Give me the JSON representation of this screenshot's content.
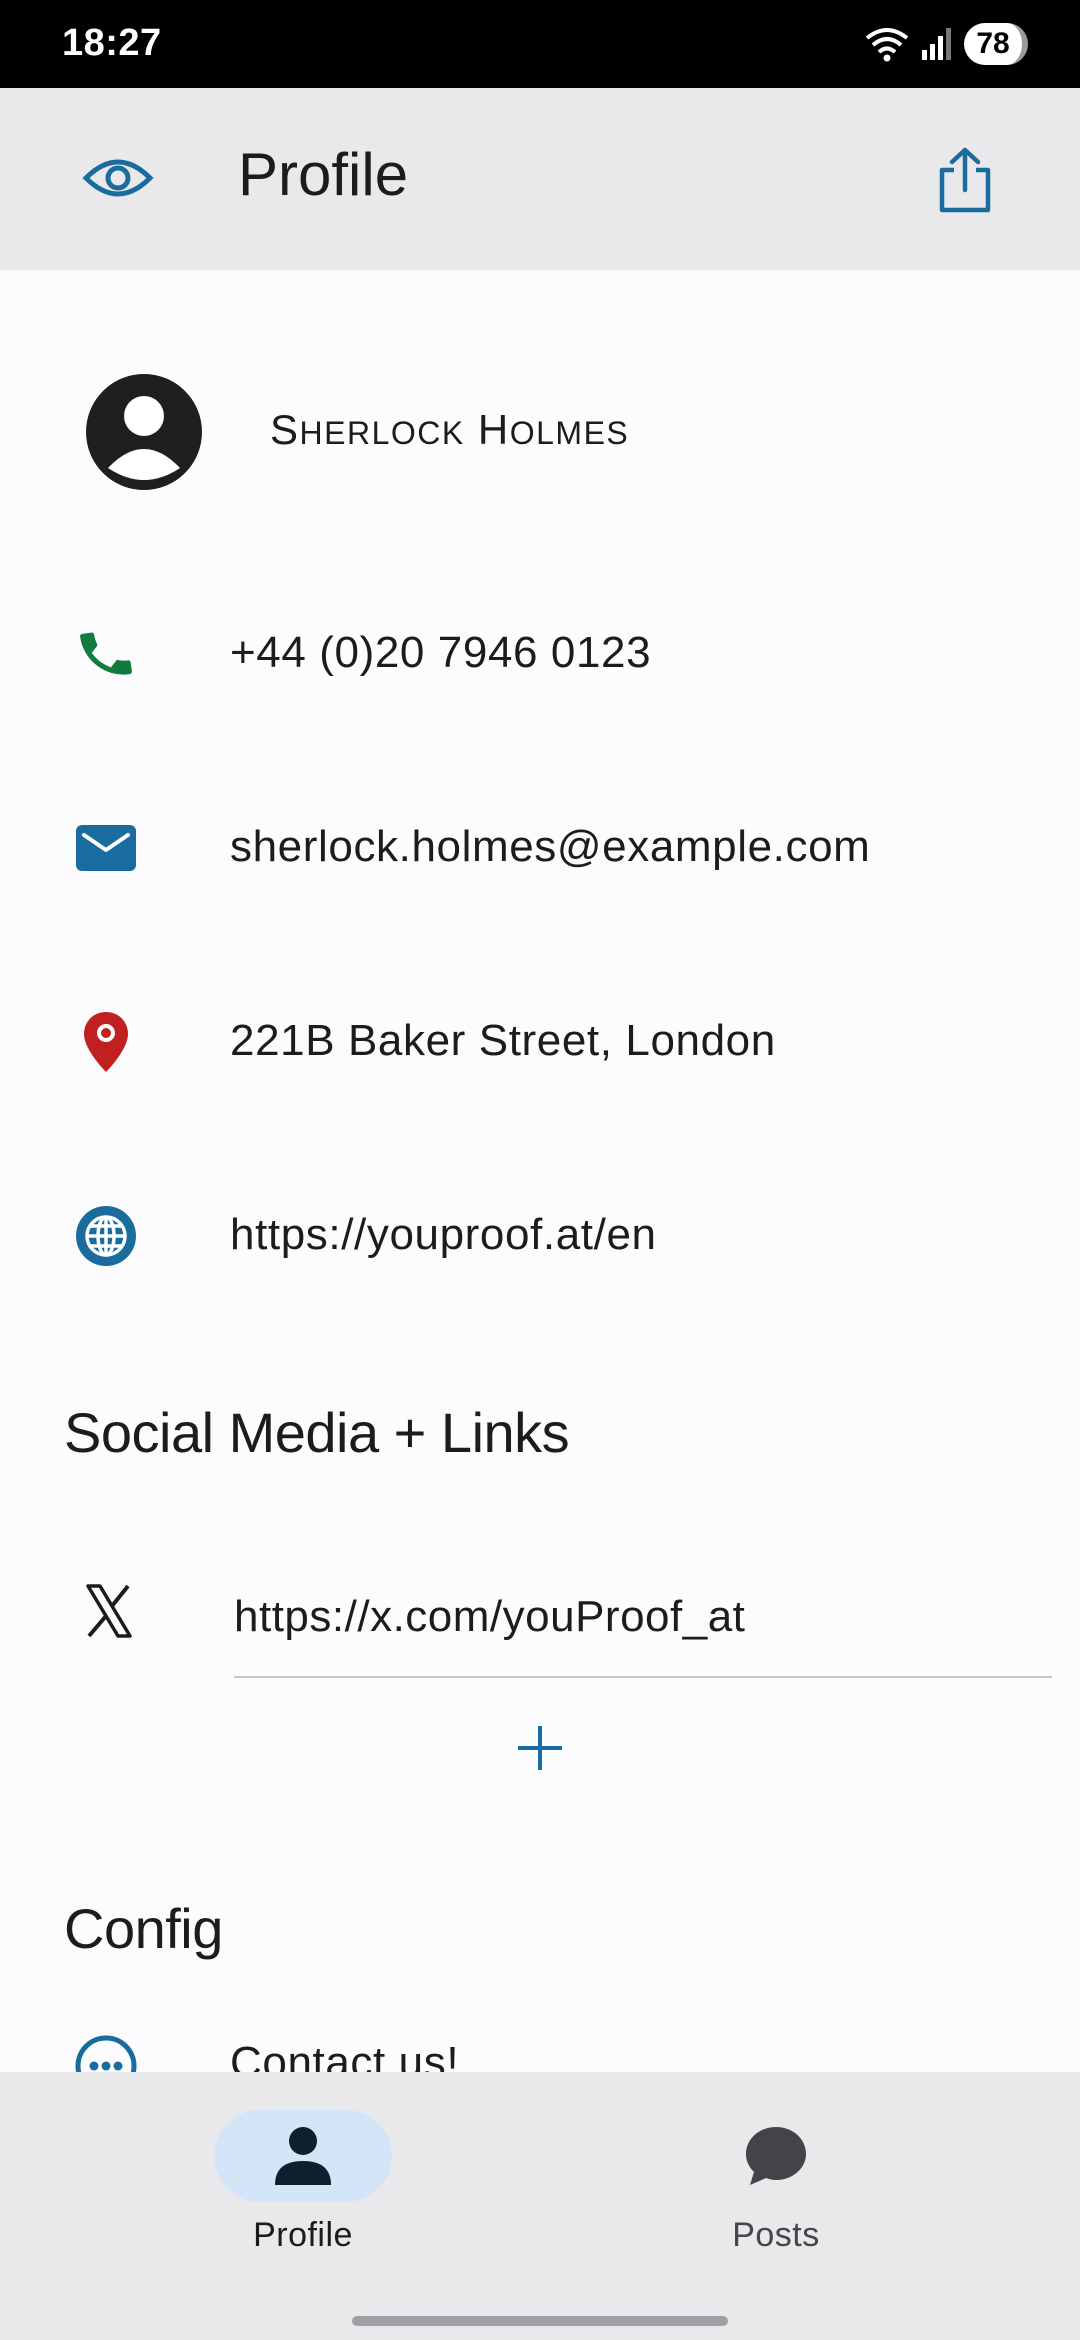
{
  "status_bar": {
    "time": "18:27",
    "battery": "78",
    "wifi_badge": "5"
  },
  "app_bar": {
    "title": "Profile",
    "left_icon": "eye-icon",
    "right_icon": "share-icon"
  },
  "profile": {
    "name": "Sherlock Holmes",
    "name_display": {
      "first_cap": "S",
      "first_rest": "HERLOCK",
      "last_cap": "H",
      "last_rest": "OLMES"
    },
    "phone": "+44 (0)20 7946 0123",
    "email": "sherlock.holmes@example.com",
    "address": "221B Baker Street, London",
    "website": "https://youproof.at/en"
  },
  "social": {
    "title": "Social Media + Links",
    "links": [
      {
        "icon": "x-logo-icon",
        "url": "https://x.com/youProof_at"
      }
    ],
    "add_icon": "plus-icon"
  },
  "config": {
    "title": "Config",
    "items": [
      {
        "icon": "chat-dots-icon",
        "label": "Contact us!"
      }
    ]
  },
  "bottom_nav": {
    "items": [
      {
        "label": "Profile",
        "icon": "person-icon",
        "active": true
      },
      {
        "label": "Posts",
        "icon": "chat-bubble-icon",
        "active": false
      }
    ]
  },
  "colors": {
    "accent_blue": "#1b6c9e",
    "phone_green": "#117a3d",
    "pin_red": "#c0201f",
    "nav_active": "#d5e5f8",
    "bar_bg": "#e9e9ec"
  }
}
